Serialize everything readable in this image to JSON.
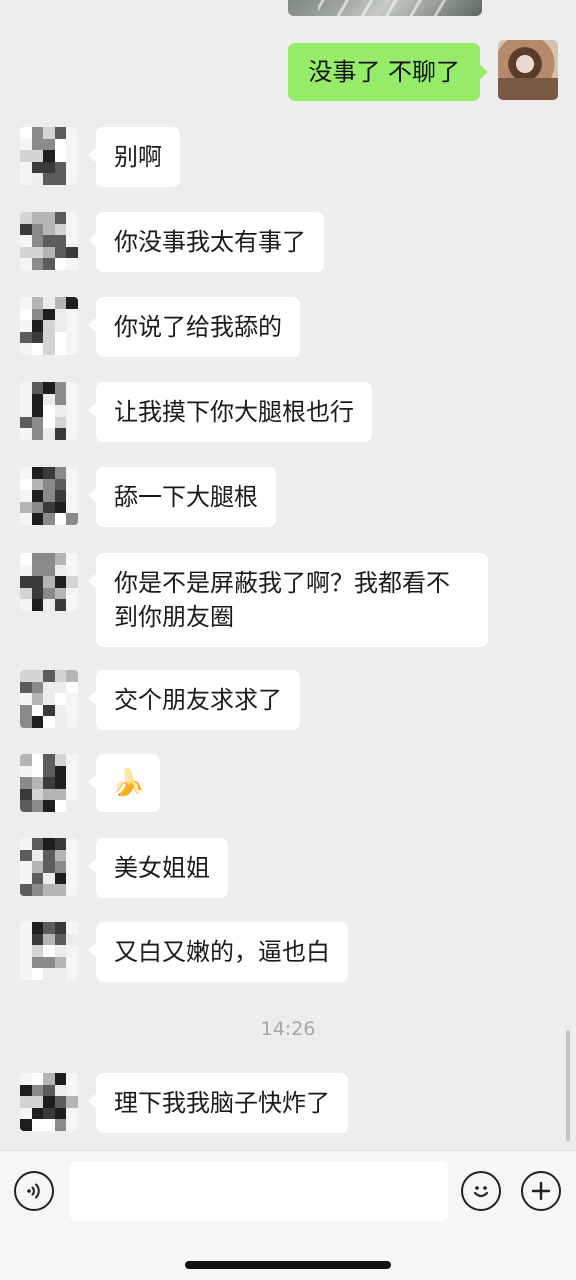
{
  "self_message": {
    "text": "没事了 不聊了"
  },
  "messages": [
    {
      "text": "别啊"
    },
    {
      "text": "你没事我太有事了"
    },
    {
      "text": "你说了给我舔的"
    },
    {
      "text": "让我摸下你大腿根也行"
    },
    {
      "text": "舔一下大腿根"
    },
    {
      "text": "你是不是屏蔽我了啊？我都看不到你朋友圈"
    },
    {
      "text": "交个朋友求求了"
    },
    {
      "text": "🍌"
    },
    {
      "text": "美女姐姐"
    },
    {
      "text": "又白又嫩的，逼也白"
    },
    {
      "text": "理下我我脑子快炸了"
    }
  ],
  "timestamp": "14:26",
  "input_bar": {
    "placeholder": ""
  },
  "colors": {
    "self_bubble": "#95ec69",
    "other_bubble": "#ffffff",
    "background": "#ededed"
  },
  "icons": {
    "voice": "voice-icon",
    "emoji": "emoji-icon",
    "plus": "plus-icon"
  }
}
